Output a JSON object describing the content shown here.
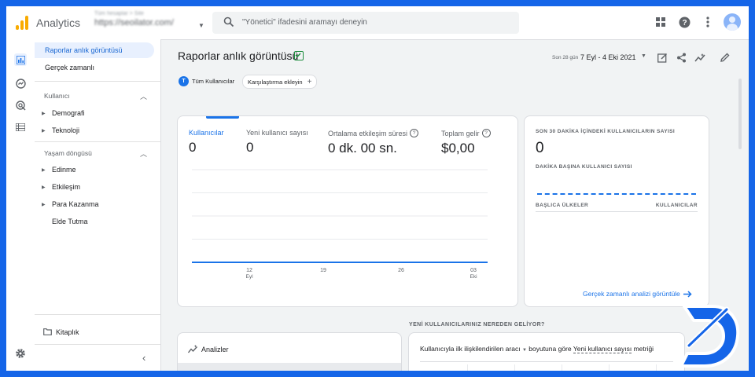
{
  "colors": {
    "accent": "#1a73e8",
    "frame": "#1565e8",
    "logo": "#f9ab00",
    "success": "#1e8e3e"
  },
  "topbar": {
    "app_title": "Analytics",
    "account_small": "Tüm hesaplar > Site",
    "account_main": "https://seoilator.com/",
    "search_placeholder": "\"Yönetici\" ifadesini aramayı deneyin",
    "icons": [
      "apps-icon",
      "help-icon",
      "more-vert-icon",
      "avatar"
    ]
  },
  "rail": {
    "icons": [
      "reports-icon",
      "explore-icon",
      "advertising-icon",
      "configure-icon",
      "settings-icon"
    ]
  },
  "nav": {
    "items": [
      {
        "label": "Raporlar anlık görüntüsü",
        "active": true
      },
      {
        "label": "Gerçek zamanlı"
      }
    ],
    "section_user": "Kullanıcı",
    "user_items": [
      {
        "label": "Demografi"
      },
      {
        "label": "Teknoloji"
      }
    ],
    "section_lifecycle": "Yaşam döngüsü",
    "lifecycle_items": [
      {
        "label": "Edinme",
        "arrow": true
      },
      {
        "label": "Etkileşim",
        "arrow": true
      },
      {
        "label": "Para Kazanma",
        "arrow": true
      },
      {
        "label": "Elde Tutma",
        "arrow": false
      }
    ],
    "library": "Kitaplık"
  },
  "main": {
    "title": "Raporlar anlık görüntüsü",
    "date_range_small": "Son 28 gün",
    "date_range": "7 Eyl - 4 Eki 2021",
    "chip_all_users": "Tüm Kullanıcılar",
    "chip_all_users_badge": "T",
    "chip_compare": "Karşılaştırma ekleyin",
    "metrics": [
      {
        "label": "Kullanıcılar",
        "value": "0",
        "help": false
      },
      {
        "label": "Yeni kullanıcı sayısı",
        "value": "0",
        "help": false
      },
      {
        "label": "Ortalama etkileşim süresi",
        "value": "0 dk. 00 sn.",
        "help": true
      },
      {
        "label": "Toplam gelir",
        "value": "$0,00",
        "help": true
      }
    ],
    "realtime": {
      "title": "SON 30 DAKİKA İÇİNDEKİ KULLANICILARIN SAYISI",
      "value": "0",
      "per_minute": "DAKİKA BAŞINA KULLANICI SAYISI",
      "col_countries": "BAŞLICA ÜLKELER",
      "col_users": "KULLANICILAR",
      "link": "Gerçek zamanlı analizi görüntüle"
    },
    "source_section_title": "YENİ KULLANICILARINIZ NEREDEN GELİYOR?",
    "insights_title": "Analizler",
    "source_text_a": "Kullanıcıyla ilk ilişkilendirilen aracı",
    "source_text_b": "boyutuna göre",
    "source_text_c": "Yeni kullanıcı sayısı",
    "source_text_d": "metriği"
  },
  "chart_data": {
    "type": "line",
    "x": [
      "12 Eyl",
      "19",
      "26",
      "03 Eki"
    ],
    "tick_labels": [
      "12",
      "19",
      "26",
      "03"
    ],
    "tick_sublabels": [
      "Eyl",
      "",
      "",
      "Eki"
    ],
    "series": [
      {
        "values": [
          0,
          0,
          0,
          0
        ]
      }
    ],
    "grid": true,
    "ylim": [
      0,
      1
    ]
  }
}
